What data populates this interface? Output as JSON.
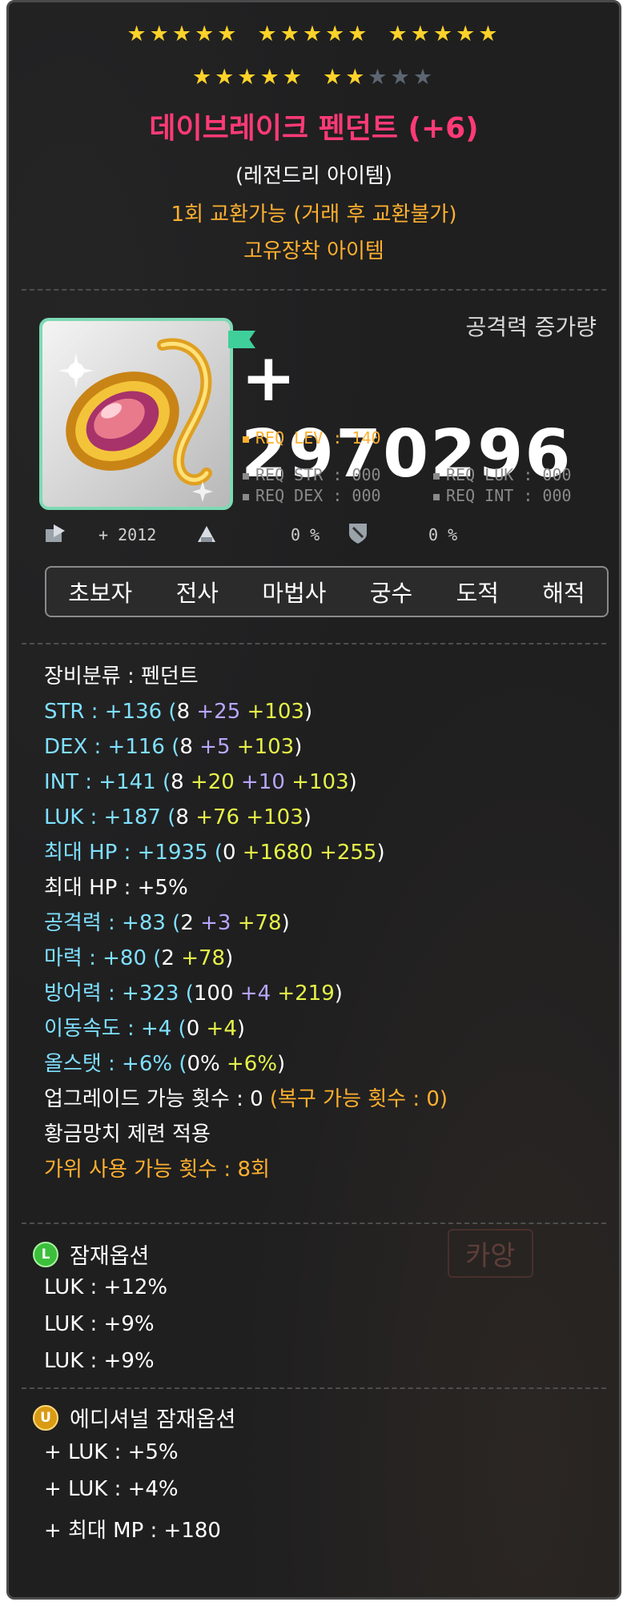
{
  "stars": {
    "row1_groups": [
      5,
      5,
      5
    ],
    "row2_filled_groups": [
      5,
      2
    ],
    "row2_empty": 3
  },
  "item_name": "데이브레이크 펜던트 (+6)",
  "grade_text": "(레전드리 아이템)",
  "trade_text": "1회 교환가능 (거래 후 교환불가)",
  "unique_text": "고유장착 아이템",
  "attack": {
    "label": "공격력 증가량",
    "value": "+ 2970296"
  },
  "requirements": {
    "lev": "REQ LEV : 140",
    "str": "REQ STR : 000",
    "luk": "REQ LUK : 000",
    "dex": "REQ DEX : 000",
    "int": "REQ INT : 000"
  },
  "small_stats": {
    "growth": "+ 2012",
    "chance1": "0 %",
    "chance2": "0 %"
  },
  "jobs": [
    "초보자",
    "전사",
    "마법사",
    "궁수",
    "도적",
    "해적"
  ],
  "stats": {
    "category": "장비분류 : 펜던트",
    "str": {
      "head": "STR : +136 (",
      "base": "8",
      "bonus": " +25",
      "star": " +103",
      "tail": ")"
    },
    "dex": {
      "head": "DEX : +116 (",
      "base": "8",
      "bonus": " +5",
      "star": " +103",
      "tail": ")"
    },
    "int": {
      "head": "INT : +141 (",
      "base": "8",
      "bonus": " +20",
      "bonus2": " +10",
      "star": " +103",
      "tail": ")"
    },
    "luk": {
      "head": "LUK : +187 (",
      "base": "8",
      "bonus": " +76",
      "star": " +103",
      "tail": ")"
    },
    "maxhp": {
      "head": "최대 HP : +1935 (",
      "base": "0",
      "bonus": " +1680",
      "star": " +255",
      "tail": ")"
    },
    "maxhp_pct": "최대 HP : +5%",
    "att": {
      "head": "공격력 : +83 (",
      "base": "2",
      "bonus": " +3",
      "star": " +78",
      "tail": ")"
    },
    "matt": {
      "head": "마력 : +80 (",
      "base": "2",
      "star": " +78",
      "tail": ")"
    },
    "def": {
      "head": "방어력 : +323 (",
      "base": "100",
      "bonus": " +4",
      "star": " +219",
      "tail": ")"
    },
    "speed": {
      "head": "이동속도 : +4 (",
      "base": "0",
      "star": " +4",
      "tail": ")"
    },
    "allstat": {
      "head": "올스탯 : +6% (",
      "base": "0%",
      "star": " +6%",
      "tail": ")"
    },
    "upgrade": "업그레이드 가능 횟수 : 0",
    "upgrade_restore": " (복구 가능 횟수 : 0)",
    "hammer": "황금망치 제련 적용",
    "scissors": "가위 사용 가능 횟수 : 8회"
  },
  "potential": {
    "badge": "L",
    "title": "잠재옵션",
    "lines": [
      "LUK : +12%",
      "LUK : +9%",
      "LUK : +9%"
    ]
  },
  "additional": {
    "badge": "U",
    "title": "에디셔널 잠재옵션",
    "lines": [
      "+ LUK : +5%",
      "+ LUK : +4%",
      "+ 최대 MP : +180"
    ]
  },
  "background_text": {
    "button": "카앙"
  },
  "colors": {
    "name": "#ff3a76",
    "gold": "#ffb02e",
    "stat_cyan": "#7fe0ff",
    "bonus_lavender": "#b9a6ff",
    "star_yellow": "#e6f248",
    "frame_green": "#7dd9b4"
  }
}
